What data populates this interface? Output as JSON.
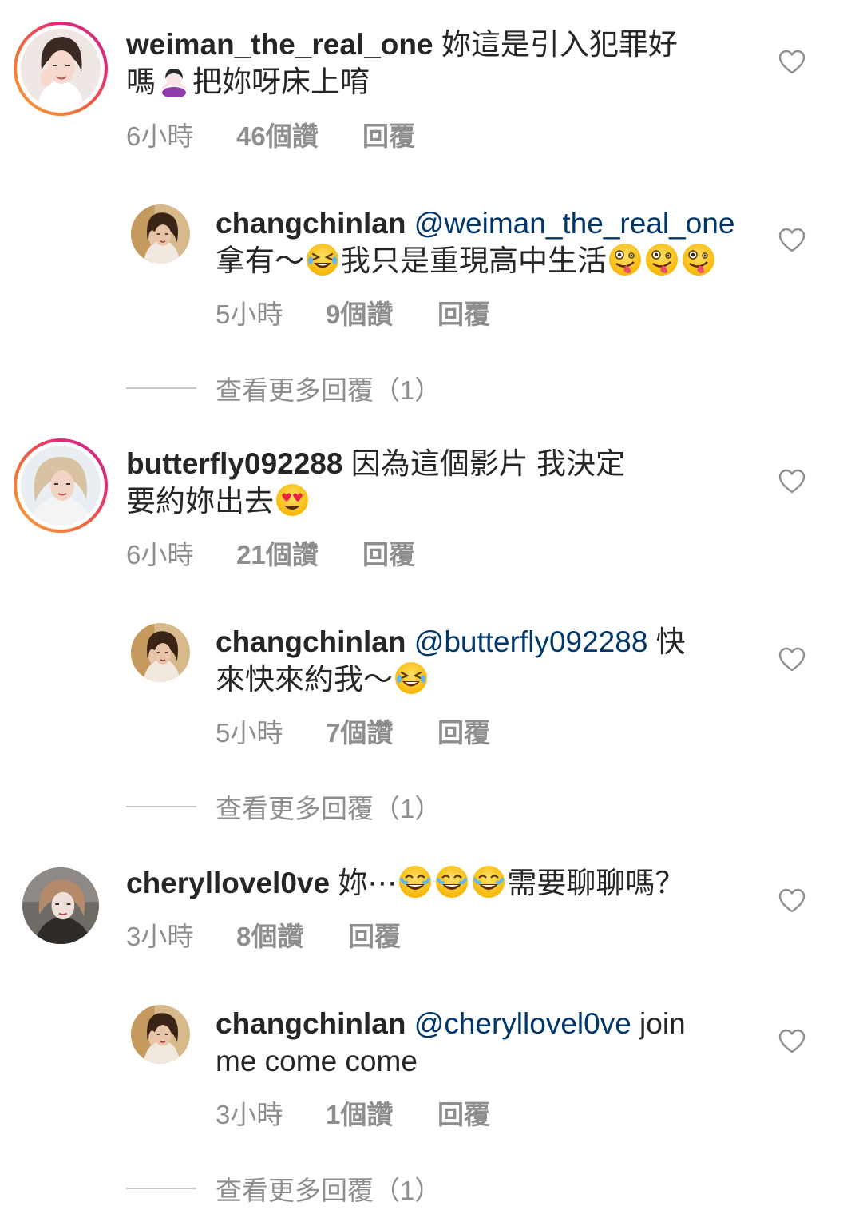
{
  "comments": [
    {
      "username": "weiman_the_real_one",
      "text_line1": " 妳這是引入犯罪好",
      "text_line2_pre": "嗎",
      "emoji": "person-gesturing-no-emoji",
      "text_line2_post": "把妳呀床上唷",
      "time": "6小時",
      "likes": "46個讚",
      "reply": "回覆",
      "reply_item": {
        "username": "changchinlan",
        "mention": " @weiman_the_real_one",
        "line2_pre": "拿有～",
        "emoji1": "rolling-laughing-emoji",
        "line2_mid": "我只是重現高中生活",
        "emojis_end": [
          "zany-face-emoji",
          "zany-face-emoji",
          "zany-face-emoji"
        ],
        "time": "5小時",
        "likes": "9個讚",
        "reply": "回覆"
      },
      "view_more": "查看更多回覆（1）"
    },
    {
      "username": "butterfly092288",
      "text_line1": " 因為這個影片 我決定",
      "text_line2_pre": "要約妳出去",
      "emoji": "heart-eyes-emoji",
      "time": "6小時",
      "likes": "21個讚",
      "reply": "回覆",
      "reply_item": {
        "username": "changchinlan",
        "mention": " @butterfly092288",
        "line1_post": " 快",
        "line2_pre": "來快來約我～",
        "emoji1": "rolling-laughing-emoji",
        "time": "5小時",
        "likes": "7個讚",
        "reply": "回覆"
      },
      "view_more": "查看更多回覆（1）"
    },
    {
      "username": "cheryllovel0ve",
      "text_pre": " 妳⋯",
      "emojis": [
        "joy-emoji",
        "joy-emoji",
        "joy-emoji"
      ],
      "text_post": "需要聊聊嗎？",
      "time": "3小時",
      "likes": "8個讚",
      "reply": "回覆",
      "reply_item": {
        "username": "changchinlan",
        "mention": " @cheryllovel0ve",
        "line1_post": " join",
        "line2": "me come come",
        "time": "3小時",
        "likes": "1個讚",
        "reply": "回覆"
      },
      "view_more": "查看更多回覆（1）"
    }
  ],
  "colors": {
    "text": "#262626",
    "meta": "#8e8e8e",
    "mention": "#00376b",
    "story_ring_start": "#f9a43a",
    "story_ring_end": "#c13584"
  }
}
